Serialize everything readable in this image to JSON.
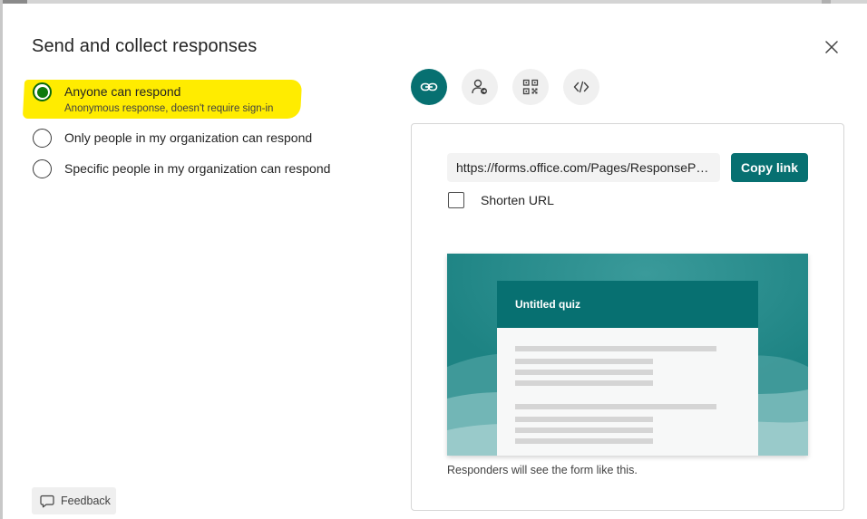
{
  "dialog": {
    "title": "Send and collect responses",
    "close_icon": "close-icon"
  },
  "access_options": [
    {
      "label": "Anyone can respond",
      "sublabel": "Anonymous response, doesn't require sign-in",
      "selected": true
    },
    {
      "label": "Only people in my organization can respond",
      "selected": false
    },
    {
      "label": "Specific people in my organization can respond",
      "selected": false
    }
  ],
  "share_tabs": [
    {
      "icon": "link-icon",
      "active": true
    },
    {
      "icon": "person-invite-icon",
      "active": false
    },
    {
      "icon": "qr-code-icon",
      "active": false
    },
    {
      "icon": "embed-code-icon",
      "active": false
    }
  ],
  "link_panel": {
    "url": "https://forms.office.com/Pages/ResponsePage.aspx",
    "copy_label": "Copy link",
    "shorten_label": "Shorten URL",
    "shorten_checked": false
  },
  "preview": {
    "form_title": "Untitled quiz",
    "caption": "Responders will see the form like this."
  },
  "feedback": {
    "label": "Feedback",
    "icon": "comment-icon"
  },
  "colors": {
    "accent": "#077071",
    "radio_selected": "#0e7a0d",
    "highlight": "#ffec00"
  }
}
